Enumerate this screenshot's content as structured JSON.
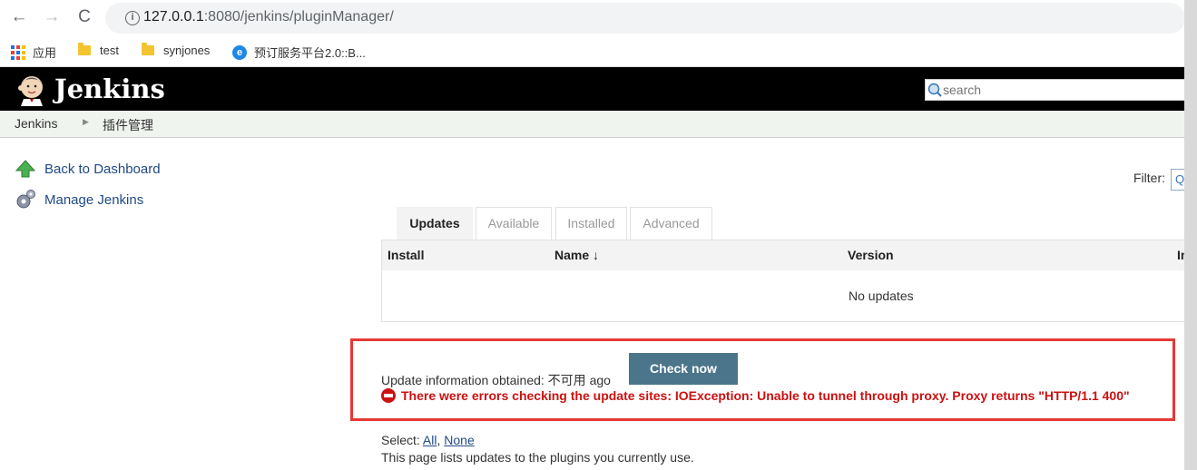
{
  "browser": {
    "url_host": "127.0.0.1",
    "url_port": ":8080",
    "url_path": "/jenkins/pluginManager/",
    "bookmarks": [
      {
        "label": "应用",
        "icon": "apps-grid-icon"
      },
      {
        "label": "test",
        "icon": "folder-icon"
      },
      {
        "label": "synjones",
        "icon": "folder-icon"
      },
      {
        "label": "预订服务平台2.0::B...",
        "icon": "browser-e-icon"
      }
    ]
  },
  "header": {
    "title": "Jenkins",
    "search_placeholder": "search"
  },
  "breadcrumb": {
    "items": [
      "Jenkins",
      "插件管理"
    ]
  },
  "sidebar": {
    "items": [
      {
        "label": "Back to Dashboard",
        "icon": "up-arrow-icon"
      },
      {
        "label": "Manage Jenkins",
        "icon": "gear-icon"
      }
    ]
  },
  "filter": {
    "label": "Filter:"
  },
  "tabs": [
    {
      "label": "Updates",
      "active": true
    },
    {
      "label": "Available",
      "active": false
    },
    {
      "label": "Installed",
      "active": false
    },
    {
      "label": "Advanced",
      "active": false
    }
  ],
  "table": {
    "columns": [
      "Install",
      "Name ↓",
      "Version",
      "In"
    ],
    "empty_message": "No updates"
  },
  "update_status": {
    "text": "Update information obtained: 不可用 ago",
    "check_button": "Check now",
    "error": "There were errors checking the update sites: IOException: Unable to tunnel through proxy. Proxy returns \"HTTP/1.1 400\""
  },
  "select": {
    "label": "Select: ",
    "all": "All",
    "separator": ", ",
    "none": "None"
  },
  "description": "This page lists updates to the plugins you currently use.",
  "colors": {
    "header_bg": "#000000",
    "check_button": "#4b758b",
    "error": "#cc1111",
    "highlight_box": "#e53935"
  }
}
